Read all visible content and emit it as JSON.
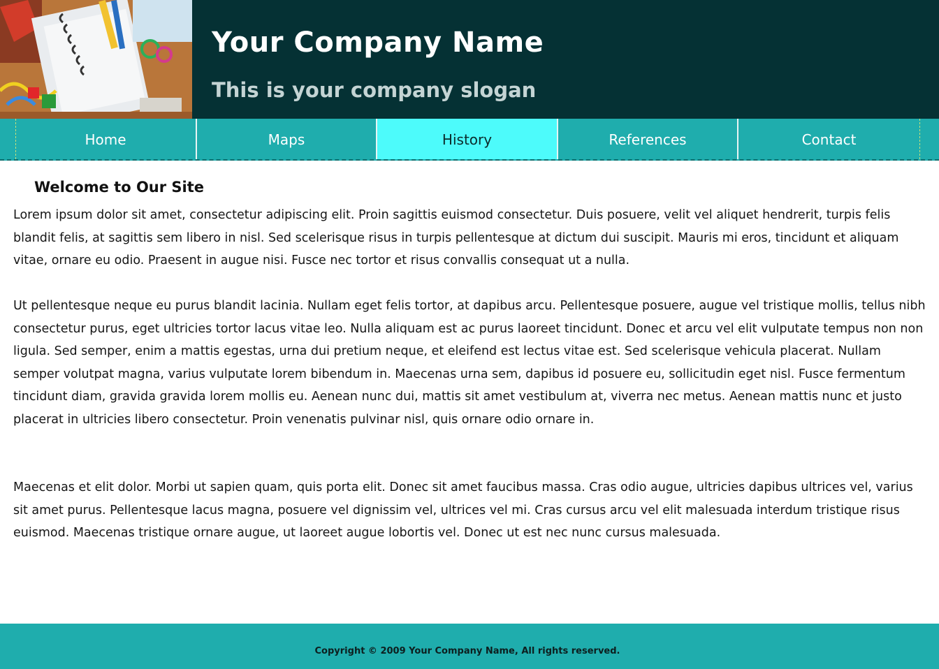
{
  "header": {
    "company_name": "Your Company Name",
    "slogan": "This is your company slogan",
    "image_icon": "office-supplies-photo"
  },
  "nav": {
    "items": [
      {
        "label": "Home",
        "active": false
      },
      {
        "label": "Maps",
        "active": false
      },
      {
        "label": "History",
        "active": true
      },
      {
        "label": "References",
        "active": false
      },
      {
        "label": "Contact",
        "active": false
      }
    ]
  },
  "content": {
    "title": "Welcome to Our Site",
    "paragraphs": [
      "Lorem ipsum dolor sit amet, consectetur adipiscing elit. Proin sagittis euismod consectetur. Duis posuere, velit vel aliquet hendrerit, turpis felis blandit felis, at sagittis sem libero in nisl. Sed scelerisque risus in turpis pellentesque at dictum dui suscipit. Mauris mi eros, tincidunt et aliquam vitae, ornare eu odio. Praesent in augue nisi. Fusce nec tortor et risus convallis consequat ut a nulla.",
      "Ut pellentesque neque eu purus blandit lacinia. Nullam eget felis tortor, at dapibus arcu. Pellentesque posuere, augue vel tristique mollis, tellus nibh consectetur purus, eget ultricies tortor lacus vitae leo. Nulla aliquam est ac purus laoreet tincidunt. Donec et arcu vel elit vulputate tempus non non ligula. Sed semper, enim a mattis egestas, urna dui pretium neque, et eleifend est lectus vitae est. Sed scelerisque vehicula placerat. Nullam semper volutpat magna, varius vulputate lorem bibendum in. Maecenas urna sem, dapibus id posuere eu, sollicitudin eget nisl. Fusce fermentum tincidunt diam, gravida gravida lorem mollis eu. Aenean nunc dui, mattis sit amet vestibulum at, viverra nec metus. Aenean mattis nunc et justo placerat in ultricies libero consectetur. Proin venenatis pulvinar nisl, quis ornare odio ornare in.",
      "Maecenas et elit dolor. Morbi ut sapien quam, quis porta elit. Donec sit amet faucibus massa. Cras odio augue, ultricies dapibus ultrices vel, varius sit amet purus. Pellentesque lacus magna, posuere vel dignissim vel, ultrices vel mi. Cras cursus arcu vel elit malesuada interdum tristique risus euismod. Maecenas tristique ornare augue, ut laoreet augue lobortis vel. Donec ut est nec nunc cursus malesuada."
    ]
  },
  "footer": {
    "copyright": "Copyright © 2009 Your Company Name, All rights reserved."
  },
  "colors": {
    "header_bg": "#053134",
    "nav_bg": "#1fadad",
    "nav_active_bg": "#4dfbfb",
    "footer_bg": "#1fadad"
  }
}
